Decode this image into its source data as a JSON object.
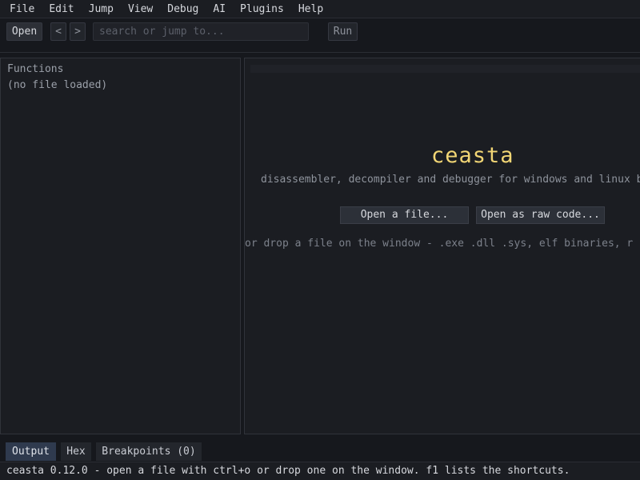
{
  "menu": {
    "items": [
      "File",
      "Edit",
      "Jump",
      "View",
      "Debug",
      "AI",
      "Plugins",
      "Help"
    ]
  },
  "toolbar": {
    "open_label": "Open",
    "back_label": "<",
    "forward_label": ">",
    "search_placeholder": "search or jump to...",
    "run_label": "Run"
  },
  "functions_panel": {
    "header": "Functions",
    "empty_text": "(no file loaded)"
  },
  "welcome": {
    "title": "ceasta",
    "subtitle": "disassembler, decompiler and debugger for windows and linux b",
    "open_file_label": "Open a file...",
    "open_raw_label": "Open as raw code...",
    "hint": "or drop a file on the window  -  .exe .dll .sys, elf binaries, r"
  },
  "bottom_tabs": {
    "output_label": "Output",
    "hex_label": "Hex",
    "breakpoints_label": "Breakpoints (0)"
  },
  "status": {
    "text": "ceasta 0.12.0 - open a file with ctrl+o or drop one on the window. f1 lists the shortcuts."
  },
  "colors": {
    "accent_title": "#f2d675",
    "active_tab": "#2f3a4e",
    "background": "#16181d",
    "panel": "#1b1d22"
  }
}
